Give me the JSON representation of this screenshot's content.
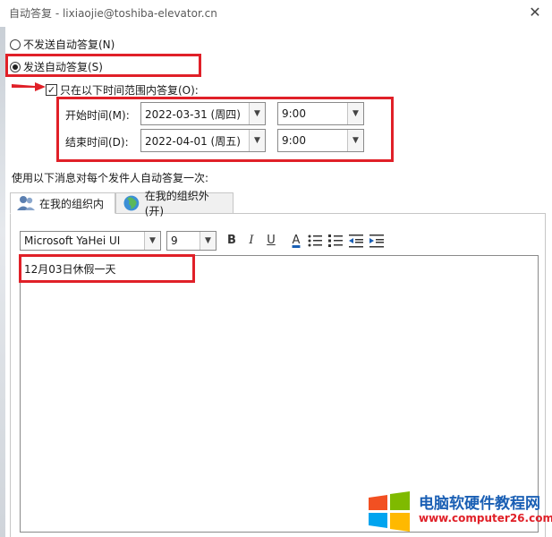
{
  "window": {
    "title": "自动答复 - lixiaojie@toshiba-elevator.cn",
    "close_glyph": "✕"
  },
  "options": {
    "no_reply_label": "不发送自动答复(N)",
    "send_reply_label": "发送自动答复(S)",
    "time_range_label": "只在以下时间范围内答复(O):",
    "time_range_checked": true
  },
  "schedule": {
    "start_label": "开始时间(M):",
    "start_date": "2022-03-31 (周四)",
    "start_time": "9:00",
    "end_label": "结束时间(D):",
    "end_date": "2022-04-01 (周五)",
    "end_time": "9:00"
  },
  "info_text": "使用以下消息对每个发件人自动答复一次:",
  "tabs": {
    "inside": "在我的组织内",
    "outside": "在我的组织外(开)"
  },
  "toolbar": {
    "font_name": "Microsoft YaHei UI",
    "font_size": "9",
    "bold": "B",
    "italic": "I",
    "underline": "U",
    "font_color": "A",
    "dropdown_glyph": "▼"
  },
  "editor": {
    "message": "12月03日休假一天"
  },
  "watermark": {
    "title": "电脑软硬件教程网",
    "url": "www.computer26.com"
  },
  "colors": {
    "highlight": "#e02028",
    "watermark_blue": "#1a5fb4"
  }
}
